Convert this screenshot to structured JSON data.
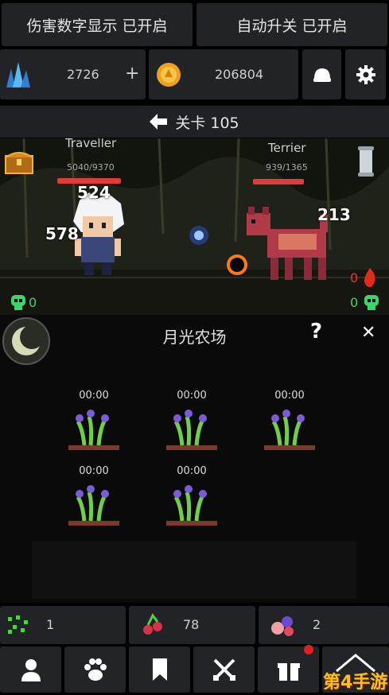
{
  "toggles": {
    "damage_numbers": "伤害数字显示 已开启",
    "auto_upgrade": "自动升关 已开启"
  },
  "resources": {
    "crystal": "2726",
    "add": "+",
    "gold": "206804"
  },
  "stage": {
    "label": "关卡 105"
  },
  "battle": {
    "player": {
      "name": "Traveller",
      "hp": "5040/9370",
      "hp_fraction": 0.54
    },
    "enemy": {
      "name": "Terrier",
      "hp": "939/1365",
      "hp_fraction": 0.69
    },
    "damage_numbers": [
      "524",
      "578",
      "213"
    ],
    "player_kills": "0",
    "enemy_kills": "0",
    "enemy_fire": "0"
  },
  "farm": {
    "title": "月光农场",
    "help": "?",
    "close": "✕",
    "plots": [
      {
        "timer": "00:00"
      },
      {
        "timer": "00:00"
      },
      {
        "timer": "00:00"
      },
      {
        "timer": "00:00"
      },
      {
        "timer": "00:00"
      }
    ]
  },
  "inventory": [
    {
      "count": "1",
      "icon": "green-seeds-icon"
    },
    {
      "count": "78",
      "icon": "red-berries-icon"
    },
    {
      "count": "2",
      "icon": "pink-fruit-icon"
    }
  ],
  "watermark": "第4手游",
  "colors": {
    "hp": "#e23b3b",
    "skull": "#3ed46a",
    "gold": "#f0a020",
    "crystal": "#4aa8f0"
  }
}
